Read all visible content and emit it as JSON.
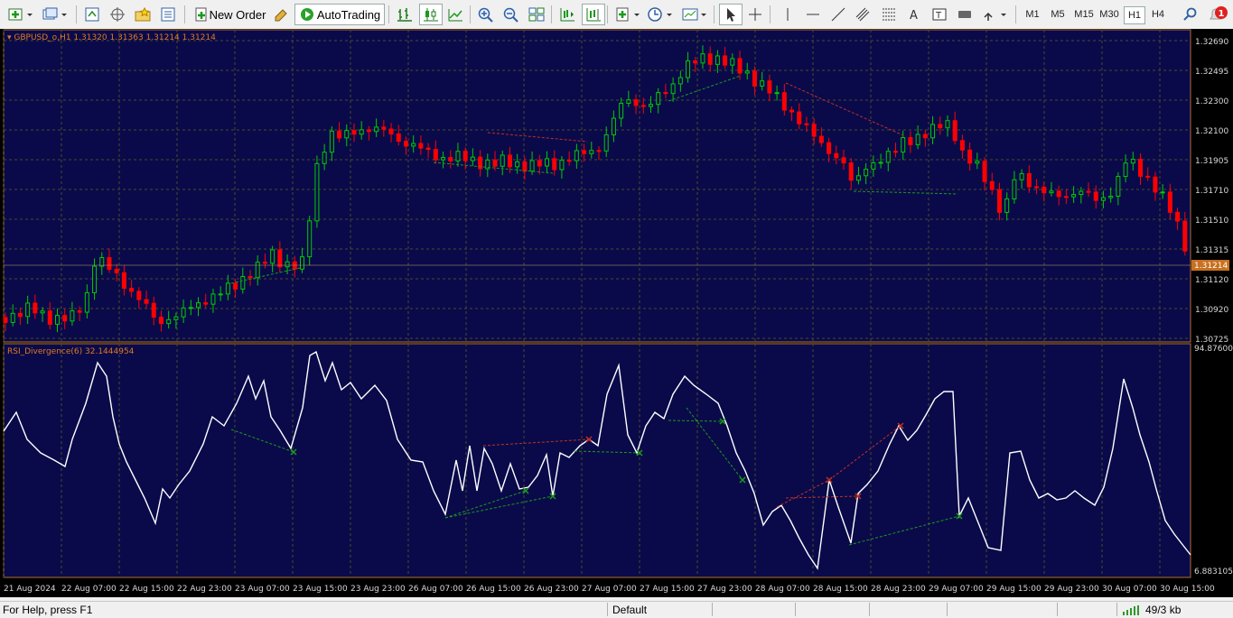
{
  "toolbar": {
    "new_order_label": "New Order",
    "autotrading_label": "AutoTrading",
    "timeframes": [
      "M1",
      "M5",
      "M15",
      "M30",
      "H1",
      "H4"
    ],
    "active_timeframe": "H1",
    "notification_count": "1"
  },
  "price_panel": {
    "header": "GBPUSD_o,H1  1.31320 1.31363 1.31214 1.31214",
    "price_labels": [
      "1.32690",
      "1.32495",
      "1.32300",
      "1.32100",
      "1.31905",
      "1.31710",
      "1.31510",
      "1.31315",
      "1.31120",
      "1.30920",
      "1.30725"
    ],
    "current_price": "1.31214",
    "background": "#0a0a4a",
    "bull_color": "#00cc00",
    "bear_color": "#ff0000"
  },
  "indicator_panel": {
    "header": "RSI_Divergence(6) 32.1444954",
    "max_label": "94.876006",
    "min_label": "6.8831059"
  },
  "time_axis": [
    "21 Aug 2024",
    "22 Aug 07:00",
    "22 Aug 15:00",
    "22 Aug 23:00",
    "23 Aug 07:00",
    "23 Aug 15:00",
    "23 Aug 23:00",
    "26 Aug 07:00",
    "26 Aug 15:00",
    "26 Aug 23:00",
    "27 Aug 07:00",
    "27 Aug 15:00",
    "27 Aug 23:00",
    "28 Aug 07:00",
    "28 Aug 15:00",
    "28 Aug 23:00",
    "29 Aug 07:00",
    "29 Aug 15:00",
    "29 Aug 23:00",
    "30 Aug 07:00",
    "30 Aug 15:00"
  ],
  "statusbar": {
    "help": "For Help, press F1",
    "profile": "Default",
    "traffic": "49/3 kb"
  }
}
